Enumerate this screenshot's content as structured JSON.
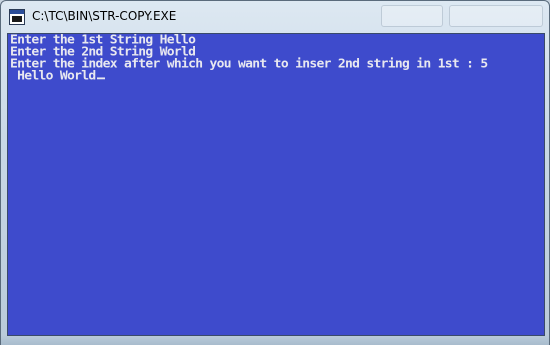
{
  "window": {
    "title": "C:\\TC\\BIN\\STR-COPY.EXE"
  },
  "console": {
    "lines": [
      "Enter the 1st String Hello",
      "Enter the 2nd String World",
      "Enter the index after which you want to inser 2nd string in 1st : 5",
      " Hello World"
    ],
    "background_color": "#3e4bcc",
    "text_color": "#e8e8f0"
  },
  "icons": {
    "title_icon": "dos-console-icon",
    "cursor": "text-cursor"
  }
}
